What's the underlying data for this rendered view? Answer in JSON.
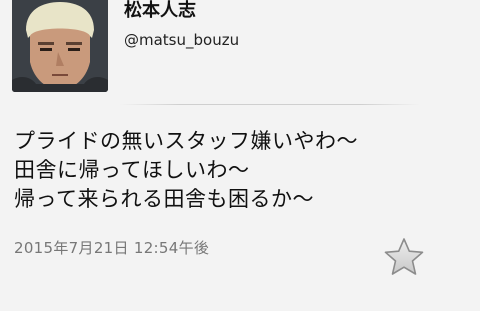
{
  "user": {
    "display_name": "松本人志",
    "handle": "@matsu_bouzu"
  },
  "tweet": {
    "lines": [
      "プライドの無いスタッフ嫌いやわ～",
      "田舎に帰ってほしいわ～",
      "帰って来られる田舎も困るか～"
    ],
    "timestamp": "2015年7月21日 12:54午後"
  },
  "icons": {
    "favorite": "star-icon"
  },
  "colors": {
    "background": "#f3f3f3",
    "timestamp": "#777777",
    "star_fill": "#d9d9d9"
  }
}
